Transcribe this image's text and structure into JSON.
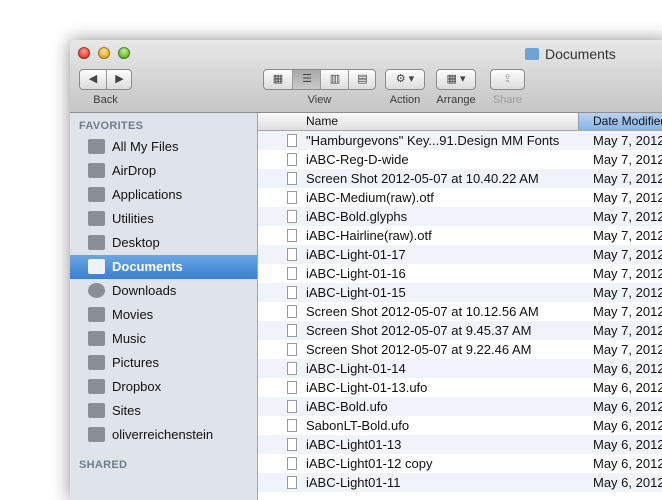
{
  "window": {
    "title": "Documents"
  },
  "toolbar": {
    "back_label": "Back",
    "view_label": "View",
    "action_label": "Action",
    "arrange_label": "Arrange",
    "share_label": "Share",
    "back_arrow": "◀",
    "fwd_arrow": "▶",
    "gear": "⚙ ▾",
    "arrange_glyph": "▦ ▾",
    "share_glyph": "⇪"
  },
  "sidebar": {
    "favorites_header": "FAVORITES",
    "shared_header": "SHARED",
    "items": [
      {
        "label": "All My Files",
        "icon": "all-files-icon"
      },
      {
        "label": "AirDrop",
        "icon": "airdrop-icon"
      },
      {
        "label": "Applications",
        "icon": "applications-icon"
      },
      {
        "label": "Utilities",
        "icon": "utilities-icon"
      },
      {
        "label": "Desktop",
        "icon": "desktop-icon"
      },
      {
        "label": "Documents",
        "icon": "documents-icon",
        "selected": true
      },
      {
        "label": "Downloads",
        "icon": "downloads-icon"
      },
      {
        "label": "Movies",
        "icon": "movies-icon"
      },
      {
        "label": "Music",
        "icon": "music-icon"
      },
      {
        "label": "Pictures",
        "icon": "pictures-icon"
      },
      {
        "label": "Dropbox",
        "icon": "folder-icon"
      },
      {
        "label": "Sites",
        "icon": "folder-icon"
      },
      {
        "label": "oliverreichenstein",
        "icon": "home-icon"
      }
    ]
  },
  "list": {
    "col_name": "Name",
    "col_date": "Date Modified",
    "rows": [
      {
        "name": "\"Hamburgevons\" Key...91.Design MM Fonts",
        "date": "May 7, 2012"
      },
      {
        "name": "iABC-Reg-D-wide",
        "date": "May 7, 2012"
      },
      {
        "name": "Screen Shot 2012-05-07 at 10.40.22 AM",
        "date": "May 7, 2012"
      },
      {
        "name": "iABC-Medium(raw).otf",
        "date": "May 7, 2012"
      },
      {
        "name": "iABC-Bold.glyphs",
        "date": "May 7, 2012"
      },
      {
        "name": "iABC-Hairline(raw).otf",
        "date": "May 7, 2012"
      },
      {
        "name": "iABC-Light-01-17",
        "date": "May 7, 2012"
      },
      {
        "name": "iABC-Light-01-16",
        "date": "May 7, 2012"
      },
      {
        "name": "iABC-Light-01-15",
        "date": "May 7, 2012"
      },
      {
        "name": "Screen Shot 2012-05-07 at 10.12.56 AM",
        "date": "May 7, 2012"
      },
      {
        "name": "Screen Shot 2012-05-07 at 9.45.37 AM",
        "date": "May 7, 2012"
      },
      {
        "name": "Screen Shot 2012-05-07 at 9.22.46 AM",
        "date": "May 7, 2012"
      },
      {
        "name": "iABC-Light-01-14",
        "date": "May 6, 2012"
      },
      {
        "name": "iABC-Light-01-13.ufo",
        "date": "May 6, 2012"
      },
      {
        "name": "iABC-Bold.ufo",
        "date": "May 6, 2012"
      },
      {
        "name": "SabonLT-Bold.ufo",
        "date": "May 6, 2012"
      },
      {
        "name": "iABC-Light01-13",
        "date": "May 6, 2012"
      },
      {
        "name": "iABC-Light01-12 copy",
        "date": "May 6, 2012"
      },
      {
        "name": "iABC-Light01-11",
        "date": "May 6, 2012"
      }
    ]
  }
}
